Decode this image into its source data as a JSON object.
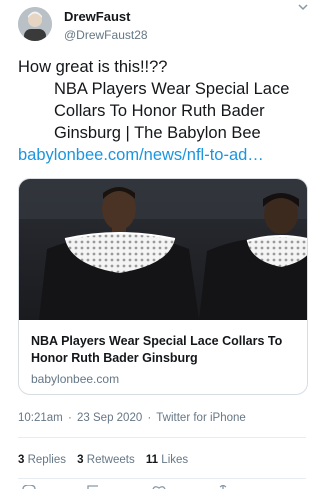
{
  "user": {
    "display_name": "DrewFaust",
    "handle": "@DrewFaust28"
  },
  "tweet": {
    "line1": "How great is this!!??",
    "line2": "NBA Players Wear Special Lace Collars To Honor Ruth Bader Ginsburg | The Babylon Bee",
    "link": "babylonbee.com/news/nfl-to-ad…"
  },
  "card": {
    "title": "NBA Players Wear Special Lace Collars To Honor Ruth Bader Ginsburg",
    "domain": "babylonbee.com"
  },
  "meta": {
    "time": "10:21am",
    "date": "23 Sep 2020",
    "source": "Twitter for iPhone",
    "separator": "·"
  },
  "stats": {
    "replies_count": "3",
    "replies_label": "Replies",
    "retweets_count": "3",
    "retweets_label": "Retweets",
    "likes_count": "11",
    "likes_label": "Likes"
  },
  "icons": [
    "chevron-down-icon",
    "reply-icon",
    "retweet-icon",
    "like-icon",
    "share-icon"
  ],
  "colors": {
    "link": "#1b95e0",
    "secondary_text": "#657786",
    "primary_text": "#14171a",
    "border": "#d7dde2"
  }
}
